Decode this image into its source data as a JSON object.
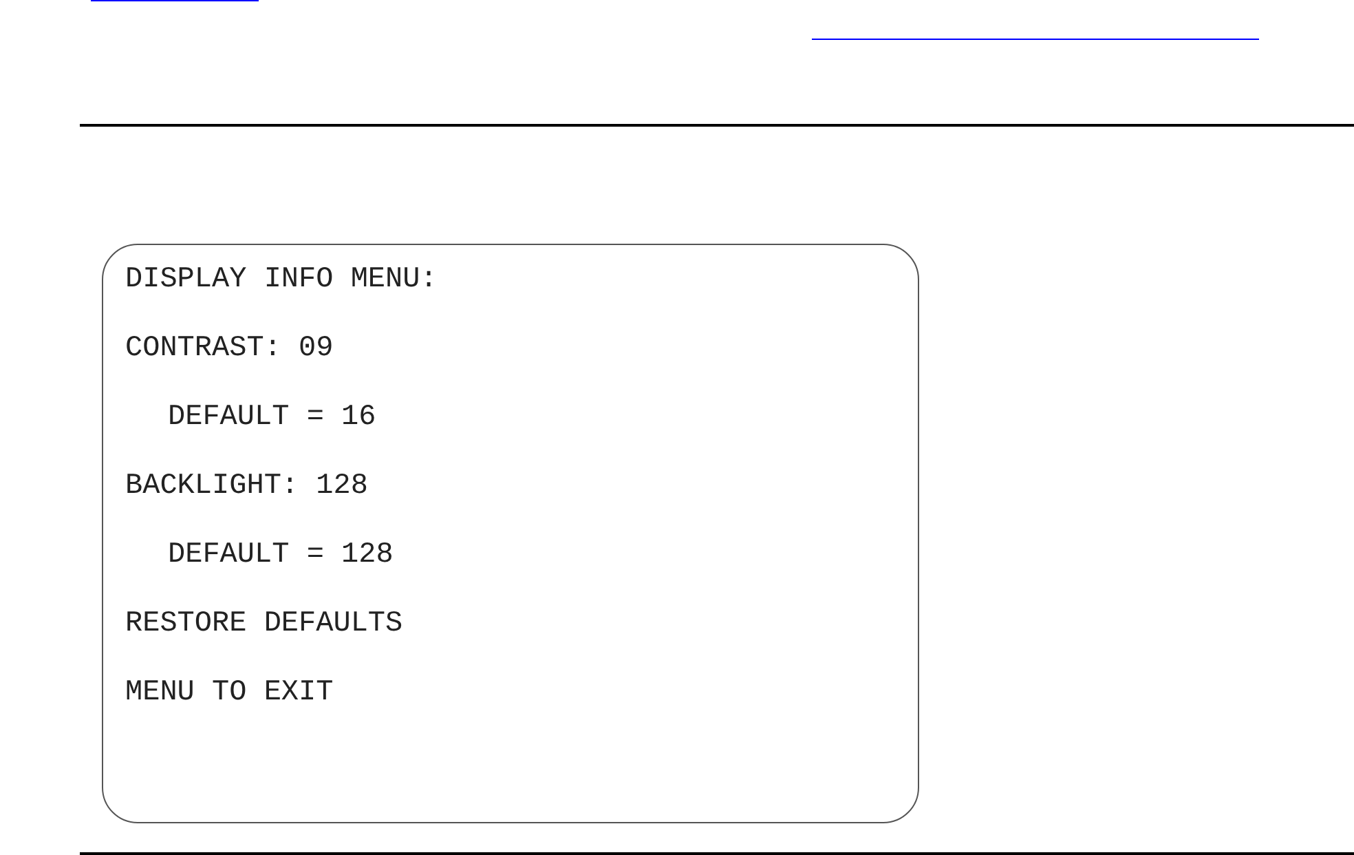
{
  "lcd_screen": {
    "title": "DISPLAY INFO MENU:",
    "items": [
      {
        "text": "CONTRAST: 09",
        "children": [
          {
            "text": "DEFAULT = 16"
          }
        ]
      },
      {
        "text": "BACKLIGHT: 128",
        "children": [
          {
            "text": "DEFAULT = 128"
          }
        ]
      },
      {
        "text": "RESTORE DEFAULTS"
      },
      {
        "text": "MENU TO EXIT"
      }
    ]
  }
}
